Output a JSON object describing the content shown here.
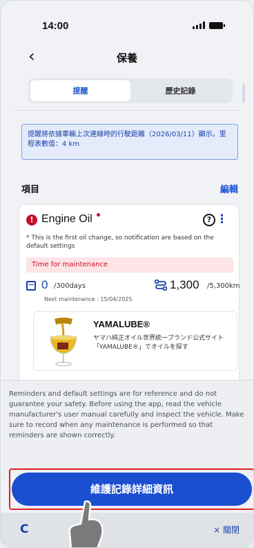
{
  "status_bar": {
    "time": "14:00"
  },
  "nav": {
    "back_icon": "‹",
    "title": "保養"
  },
  "tabs": [
    {
      "label": "提醒",
      "active": true
    },
    {
      "label": "歷史記錄",
      "active": false
    }
  ],
  "notice": {
    "text": "提醒將依據車輛上次連線時的行駛距離（2026/03/11）顯示。里程表數值：4 km"
  },
  "section": {
    "title": "項目",
    "edit_label": "編輯"
  },
  "card": {
    "alert_icon": "!",
    "title": "Engine Oil",
    "help_icon": "?",
    "more_icon": "⋮",
    "note": "* This is the first oil change, so notification are based on the default settings",
    "status": "Time for maintenance",
    "days_value": "0",
    "days_unit": "/300days",
    "next_maintenance": "Next maintenance : 15/04/2025",
    "km_value": "1,300",
    "km_unit": "/5,300km",
    "product": {
      "name": "YAMALUBE®",
      "description": "ヤマハ純正オイル世界統一ブランド公式サイト「YAMALUBE®」でオイルを探す"
    }
  },
  "disclaimer": "Reminders and default settings are for reference and do not guarantee your safety. Before using the app, read the vehicle manufacturer's user manual carefully and inspect the vehicle. Make sure to record when any maintenance is performed so that reminders are shown correctly.",
  "primary_button": {
    "label": "維護記錄詳細資訊"
  },
  "bottom_bar": {
    "refresh_icon": "C",
    "close_label": "× 關閉"
  },
  "colors": {
    "accent": "#1a4fd0",
    "alert": "#c8102e",
    "notice_bg": "#e4ecfb",
    "status_bg": "#fde4e6"
  }
}
